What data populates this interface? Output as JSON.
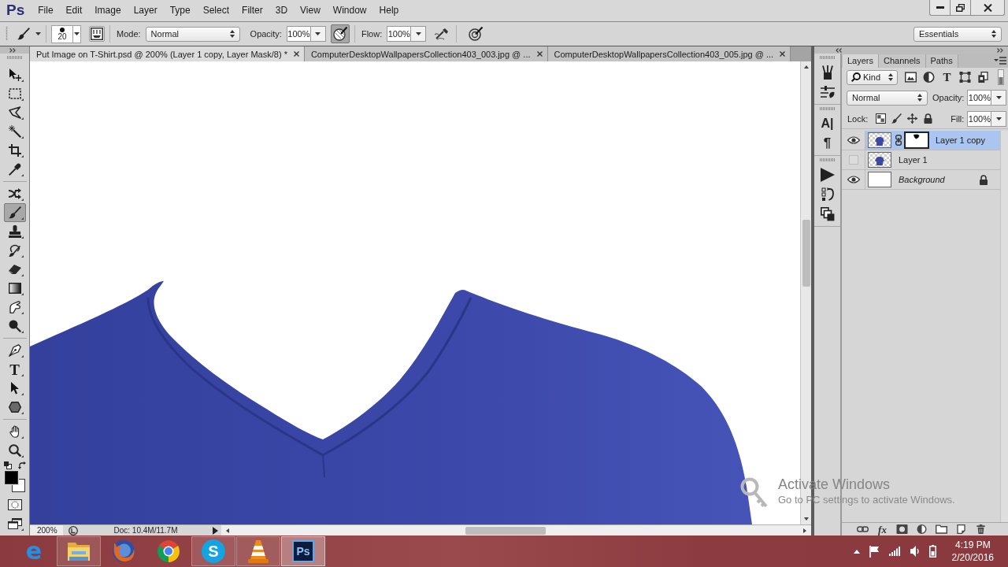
{
  "app": {
    "logo": "Ps",
    "menu": [
      "File",
      "Edit",
      "Image",
      "Layer",
      "Type",
      "Select",
      "Filter",
      "3D",
      "View",
      "Window",
      "Help"
    ]
  },
  "options_bar": {
    "brush_size": "20",
    "mode_label": "Mode:",
    "mode": "Normal",
    "opacity_label": "Opacity:",
    "opacity": "100%",
    "opacity_pressure": true,
    "flow_label": "Flow:",
    "flow": "100%",
    "airbrush": false,
    "size_pressure": false,
    "workspace": "Essentials"
  },
  "tool_groups": [
    {
      "tools": [
        {
          "kind": "move",
          "selected": false
        },
        {
          "kind": "marquee",
          "selected": false
        },
        {
          "kind": "lasso",
          "selected": false
        },
        {
          "kind": "magic-wand",
          "selected": false
        },
        {
          "kind": "crop",
          "selected": false
        },
        {
          "kind": "eyedropper",
          "selected": false
        }
      ]
    },
    {
      "tools": [
        {
          "kind": "healing",
          "selected": false
        },
        {
          "kind": "brush",
          "selected": true
        },
        {
          "kind": "stamp",
          "selected": false
        },
        {
          "kind": "history-brush",
          "selected": false
        },
        {
          "kind": "eraser",
          "selected": false
        },
        {
          "kind": "gradient",
          "selected": false
        },
        {
          "kind": "smudge",
          "selected": false
        },
        {
          "kind": "dodge",
          "selected": false
        }
      ]
    },
    {
      "tools": [
        {
          "kind": "pen",
          "selected": false
        },
        {
          "kind": "type",
          "glyph": "T",
          "selected": false
        },
        {
          "kind": "path-select",
          "selected": false
        },
        {
          "kind": "shape",
          "selected": false
        }
      ]
    },
    {
      "tools": [
        {
          "kind": "hand",
          "selected": false
        },
        {
          "kind": "zoom",
          "selected": false
        }
      ]
    }
  ],
  "color_swatches": [
    {
      "kind": "foreground",
      "color": "#000000"
    },
    {
      "kind": "background",
      "color": "#ffffff"
    }
  ],
  "document_tabs": [
    {
      "title": "Put Image on T-Shirt.psd @ 200% (Layer 1 copy, Layer Mask/8) *",
      "selected": true
    },
    {
      "title": "ComputerDesktopWallpapersCollection403_003.jpg @ ...",
      "selected": false
    },
    {
      "title": "ComputerDesktopWallpapersCollection403_005.jpg @ ...",
      "selected": false
    }
  ],
  "status_bar": {
    "zoom": "200%",
    "doc_info": "Doc: 10.4M/11.7M"
  },
  "dock_groups": [
    {
      "items": [
        {
          "kind": "brushes"
        },
        {
          "kind": "brush-presets"
        }
      ]
    },
    {
      "items": [
        {
          "kind": "character",
          "glyph": "A|"
        },
        {
          "kind": "paragraph",
          "glyph": "¶"
        }
      ]
    },
    {
      "items": [
        {
          "kind": "actions"
        },
        {
          "kind": "history"
        },
        {
          "kind": "tool-presets"
        }
      ]
    }
  ],
  "layers_panel": {
    "tabs": [
      {
        "label": "Layers",
        "selected": true
      },
      {
        "label": "Channels",
        "selected": false
      },
      {
        "label": "Paths",
        "selected": false
      }
    ],
    "filter": "Kind",
    "filter_buttons": [
      {
        "kind": "pixel"
      },
      {
        "kind": "adjustment"
      },
      {
        "kind": "type",
        "glyph": "T"
      },
      {
        "kind": "shape"
      },
      {
        "kind": "smart-object"
      }
    ],
    "blend_mode": "Normal",
    "opacity_label": "Opacity:",
    "opacity": "100%",
    "lock_label": "Lock:",
    "lock_buttons": [
      {
        "kind": "pixels"
      },
      {
        "kind": "paint"
      },
      {
        "kind": "position"
      },
      {
        "kind": "all"
      }
    ],
    "fill_label": "Fill:",
    "fill": "100%",
    "layers": [
      {
        "name": "Layer 1 copy",
        "kind": "pixel",
        "visible": true,
        "selected": true,
        "mask": true,
        "locked": false
      },
      {
        "name": "Layer 1",
        "kind": "pixel",
        "visible": false,
        "selected": false,
        "mask": false,
        "locked": false
      },
      {
        "name": "Background",
        "kind": "background",
        "visible": true,
        "selected": false,
        "mask": false,
        "locked": true
      }
    ],
    "footer_buttons": [
      {
        "kind": "link"
      },
      {
        "kind": "fx",
        "glyph": "fx"
      },
      {
        "kind": "mask"
      },
      {
        "kind": "adjustment"
      },
      {
        "kind": "group"
      },
      {
        "kind": "new"
      },
      {
        "kind": "delete"
      }
    ]
  },
  "activation_notice": {
    "title": "Activate Windows",
    "text": "Go to PC settings to activate Windows."
  },
  "taskbar": {
    "apps": [
      {
        "kind": "ie",
        "glyph": "e",
        "running": false,
        "selected": false
      },
      {
        "kind": "explorer",
        "running": true,
        "selected": false
      },
      {
        "kind": "firefox",
        "running": false,
        "selected": false
      },
      {
        "kind": "chrome",
        "running": false,
        "selected": false
      },
      {
        "kind": "skype",
        "glyph": "S",
        "running": true,
        "selected": false
      },
      {
        "kind": "vlc",
        "running": true,
        "selected": false
      },
      {
        "kind": "photoshop",
        "glyph": "Ps",
        "running": true,
        "selected": true
      }
    ],
    "time": "4:19 PM",
    "date": "2/20/2016"
  }
}
